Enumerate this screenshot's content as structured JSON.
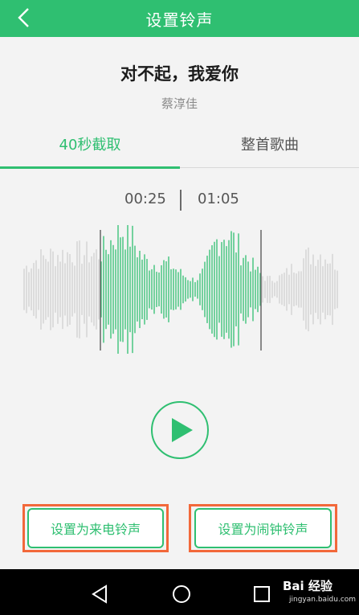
{
  "header": {
    "title": "设置铃声",
    "back_icon": "chevron-left-icon",
    "background": "#2fbf71"
  },
  "song": {
    "title": "对不起，我爱你",
    "artist": "蔡淳佳"
  },
  "tabs": [
    {
      "label": "40秒截取",
      "active": true
    },
    {
      "label": "整首歌曲",
      "active": false
    }
  ],
  "clip": {
    "start": "00:25",
    "end": "01:05"
  },
  "player": {
    "play_icon": "play-icon"
  },
  "actions": {
    "ringtone_label": "设置为来电铃声",
    "alarm_label": "设置为闹钟铃声"
  },
  "nav": {
    "back_icon": "back-triangle-icon",
    "home_icon": "home-circle-icon",
    "recent_icon": "recent-square-icon"
  },
  "watermark": {
    "logo": "Bai 经验",
    "url": "jingyan.baidu.com"
  },
  "colors": {
    "accent": "#2fbf71",
    "highlight_frame": "#f2683a",
    "wave_inactive": "#cfcfcf"
  }
}
